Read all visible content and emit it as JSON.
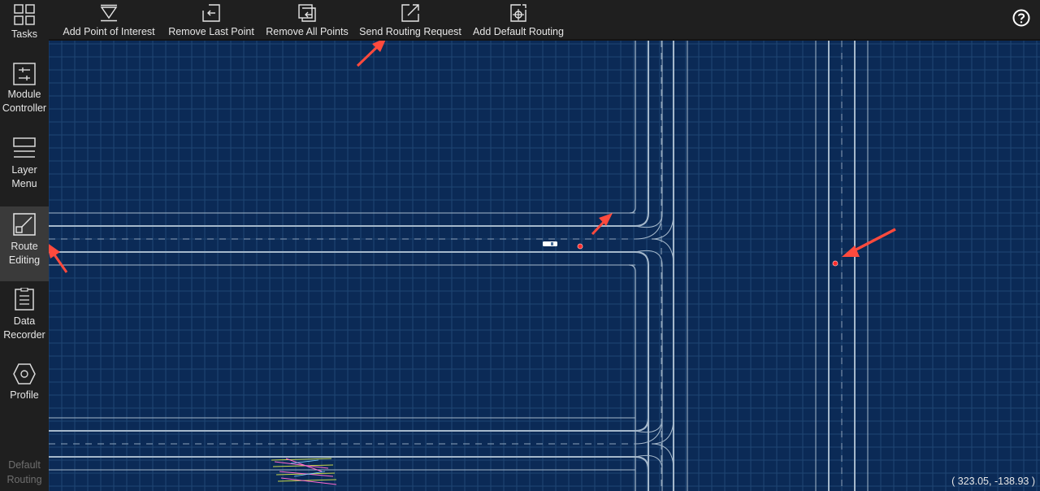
{
  "sidebar": {
    "items": [
      {
        "label_lines": [
          "Tasks"
        ],
        "icon": "grid-icon",
        "active": false
      },
      {
        "label_lines": [
          "Module",
          "Controller"
        ],
        "icon": "sliders-icon",
        "active": false
      },
      {
        "label_lines": [
          "Layer",
          "Menu"
        ],
        "icon": "layers-icon",
        "active": false
      },
      {
        "label_lines": [
          "Route",
          "Editing"
        ],
        "icon": "route-icon",
        "active": true
      },
      {
        "label_lines": [
          "Data",
          "Recorder"
        ],
        "icon": "clipboard-icon",
        "active": false
      },
      {
        "label_lines": [
          "Profile"
        ],
        "icon": "hexagon-icon",
        "active": false
      },
      {
        "label_lines": [
          "Default",
          "Routing"
        ],
        "icon": "",
        "active": false,
        "disabled": true
      }
    ]
  },
  "toolbar": {
    "items": [
      {
        "label": "Add Point of Interest",
        "icon": "add-point-icon"
      },
      {
        "label": "Remove Last Point",
        "icon": "remove-last-icon"
      },
      {
        "label": "Remove All Points",
        "icon": "remove-all-icon"
      },
      {
        "label": "Send Routing Request",
        "icon": "send-request-icon"
      },
      {
        "label": "Add Default Routing",
        "icon": "default-routing-icon"
      }
    ],
    "help_icon": "help-icon"
  },
  "map": {
    "background": "#0b2a56",
    "grid_color": "#2a4f7f",
    "lane_color": "#9fb3c8",
    "point_color": "#ff2a2a",
    "annotation_color": "#ff4a3d"
  },
  "coordinates": "( 323.05, -138.93 )"
}
